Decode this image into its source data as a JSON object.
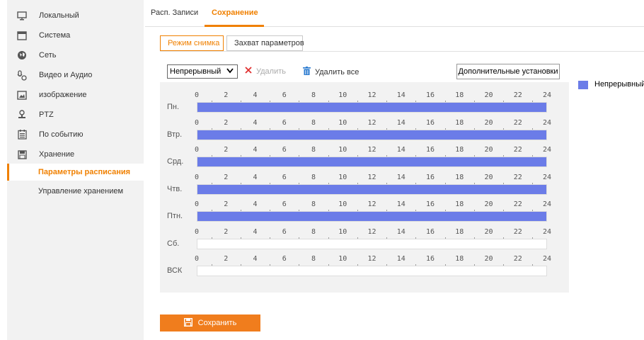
{
  "sidebar": {
    "items": [
      {
        "label": "Локальный",
        "icon": "monitor-icon"
      },
      {
        "label": "Система",
        "icon": "window-icon"
      },
      {
        "label": "Сеть",
        "icon": "globe-icon"
      },
      {
        "label": "Видео и Аудио",
        "icon": "video-audio-icon"
      },
      {
        "label": "изображение",
        "icon": "image-icon"
      },
      {
        "label": "PTZ",
        "icon": "ptz-camera-icon"
      },
      {
        "label": "По событию",
        "icon": "event-list-icon"
      },
      {
        "label": "Хранение",
        "icon": "storage-icon"
      }
    ],
    "subitems": [
      {
        "label": "Параметры расписания",
        "active": true
      },
      {
        "label": "Управление хранением",
        "active": false
      }
    ]
  },
  "tabs": {
    "items": [
      {
        "label": "Расп. Записи",
        "active": false
      },
      {
        "label": "Сохранение",
        "active": true
      }
    ]
  },
  "subtabs": {
    "items": [
      {
        "label": "Режим снимка",
        "active": true
      },
      {
        "label": "Захват параметров",
        "active": false
      }
    ]
  },
  "toolbar": {
    "mode_select_value": "Непрерывный",
    "delete_label": "Удалить",
    "delete_all_label": "Удалить все",
    "advanced_label": "Дополнительные установки"
  },
  "legend": {
    "label": "Непрерывный",
    "color": "#6b7ce8"
  },
  "schedule": {
    "hour_ticks": [
      "0",
      "2",
      "4",
      "6",
      "8",
      "10",
      "12",
      "14",
      "16",
      "18",
      "20",
      "22",
      "24"
    ],
    "days": [
      {
        "label": "Пн.",
        "segments": [
          {
            "start": 0,
            "end": 24,
            "type": "Непрерывный"
          }
        ]
      },
      {
        "label": "Втр.",
        "segments": [
          {
            "start": 0,
            "end": 24,
            "type": "Непрерывный"
          }
        ]
      },
      {
        "label": "Срд.",
        "segments": [
          {
            "start": 0,
            "end": 24,
            "type": "Непрерывный"
          }
        ]
      },
      {
        "label": "Чтв.",
        "segments": [
          {
            "start": 0,
            "end": 24,
            "type": "Непрерывный"
          }
        ]
      },
      {
        "label": "Птн.",
        "segments": [
          {
            "start": 0,
            "end": 24,
            "type": "Непрерывный"
          }
        ]
      },
      {
        "label": "Сб.",
        "segments": []
      },
      {
        "label": "ВСК",
        "segments": []
      }
    ]
  },
  "save_button": {
    "label": "Сохранить"
  },
  "colors": {
    "accent": "#f08000",
    "save_button_bg": "#f07d1d",
    "schedule_fill": "#6b7ce8",
    "delete_icon": "#e03030",
    "delete_all_icon": "#2b7bd0"
  }
}
